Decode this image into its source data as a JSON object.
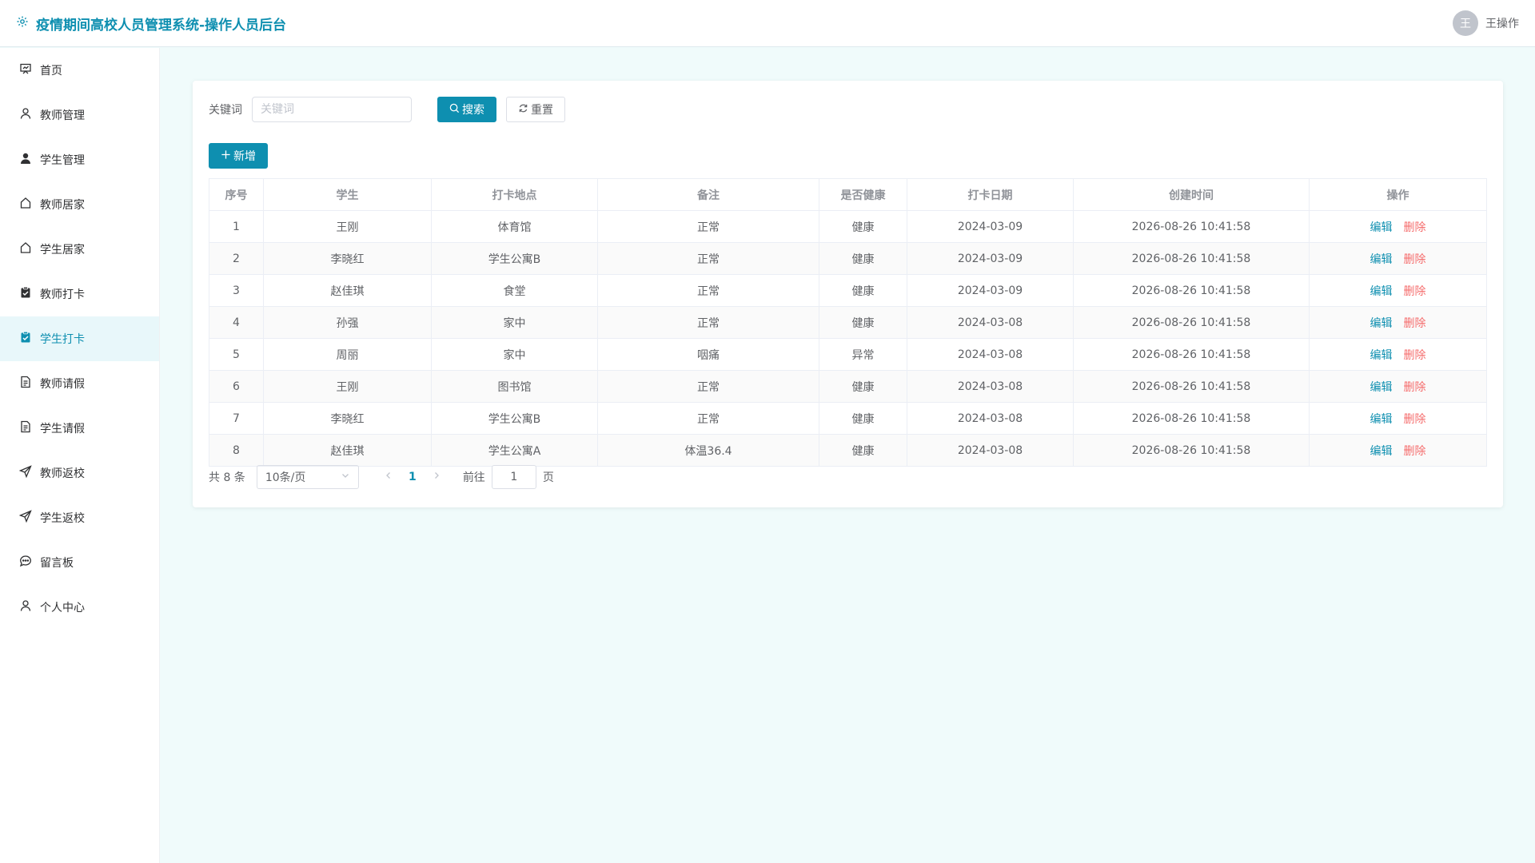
{
  "header": {
    "title": "疫情期间高校人员管理系统-操作人员后台",
    "avatar_text": "王",
    "username": "王操作"
  },
  "sidebar": {
    "items": [
      {
        "label": "首页",
        "icon": "dashboard-icon",
        "active": false
      },
      {
        "label": "教师管理",
        "icon": "user-outline-icon",
        "active": false
      },
      {
        "label": "学生管理",
        "icon": "user-solid-icon",
        "active": false
      },
      {
        "label": "教师居家",
        "icon": "house-icon",
        "active": false
      },
      {
        "label": "学生居家",
        "icon": "house-icon",
        "active": false
      },
      {
        "label": "教师打卡",
        "icon": "clipboard-check-icon",
        "active": false
      },
      {
        "label": "学生打卡",
        "icon": "clipboard-check-icon",
        "active": true
      },
      {
        "label": "教师请假",
        "icon": "document-icon",
        "active": false
      },
      {
        "label": "学生请假",
        "icon": "document-icon",
        "active": false
      },
      {
        "label": "教师返校",
        "icon": "send-icon",
        "active": false
      },
      {
        "label": "学生返校",
        "icon": "send-icon",
        "active": false
      },
      {
        "label": "留言板",
        "icon": "chat-bubble-icon",
        "active": false
      },
      {
        "label": "个人中心",
        "icon": "user-outline-icon",
        "active": false
      }
    ]
  },
  "search": {
    "label": "关键词",
    "placeholder": "关键词",
    "value": "",
    "search_label": "搜索",
    "reset_label": "重置"
  },
  "toolbar": {
    "add_label": "新增"
  },
  "table": {
    "columns": [
      "序号",
      "学生",
      "打卡地点",
      "备注",
      "是否健康",
      "打卡日期",
      "创建时间",
      "操作"
    ],
    "rows": [
      [
        "1",
        "王刚",
        "体育馆",
        "正常",
        "健康",
        "2024-03-09",
        "2026-08-26 10:41:58"
      ],
      [
        "2",
        "李晓红",
        "学生公寓B",
        "正常",
        "健康",
        "2024-03-09",
        "2026-08-26 10:41:58"
      ],
      [
        "3",
        "赵佳琪",
        "食堂",
        "正常",
        "健康",
        "2024-03-09",
        "2026-08-26 10:41:58"
      ],
      [
        "4",
        "孙强",
        "家中",
        "正常",
        "健康",
        "2024-03-08",
        "2026-08-26 10:41:58"
      ],
      [
        "5",
        "周丽",
        "家中",
        "咽痛",
        "异常",
        "2024-03-08",
        "2026-08-26 10:41:58"
      ],
      [
        "6",
        "王刚",
        "图书馆",
        "正常",
        "健康",
        "2024-03-08",
        "2026-08-26 10:41:58"
      ],
      [
        "7",
        "李晓红",
        "学生公寓B",
        "正常",
        "健康",
        "2024-03-08",
        "2026-08-26 10:41:58"
      ],
      [
        "8",
        "赵佳琪",
        "学生公寓A",
        "体温36.4",
        "健康",
        "2024-03-08",
        "2026-08-26 10:41:58"
      ]
    ],
    "edit_label": "编辑",
    "delete_label": "删除"
  },
  "pagination": {
    "total_text": "共 8 条",
    "page_size": "10条/页",
    "current_page": "1",
    "goto_prefix": "前往",
    "goto_value": "1",
    "goto_suffix": "页"
  },
  "colors": {
    "accent": "#0e8fb0",
    "danger": "#f56c6c",
    "background": "#f0fbfb"
  }
}
